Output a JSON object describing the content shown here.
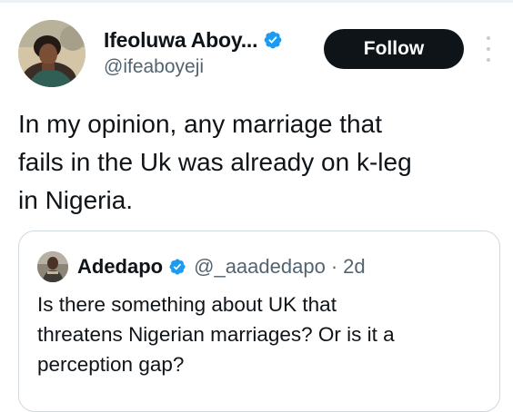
{
  "author": {
    "display_name": "Ifeoluwa Aboy...",
    "handle": "@ifeaboyeji",
    "verified_icon": "verified-badge-icon"
  },
  "follow_button": {
    "label": "Follow"
  },
  "more_menu": {
    "icon": "more-options-icon"
  },
  "tweet": {
    "line1": "In my opinion, any marriage that",
    "line2": "fails in the Uk was already on k-leg",
    "line3": "in Nigeria."
  },
  "quoted_tweet": {
    "display_name": "Adedapo",
    "handle": "@_aaadedapo",
    "separator": "·",
    "time": "2d",
    "line1": "Is there something about UK that",
    "line2": "threatens Nigerian marriages? Or is it a",
    "line3": "perception gap?"
  },
  "colors": {
    "verified_blue": "#1d9bf0",
    "primary_text": "#0f1419",
    "secondary_text": "#536471",
    "border": "#cfd9de"
  }
}
